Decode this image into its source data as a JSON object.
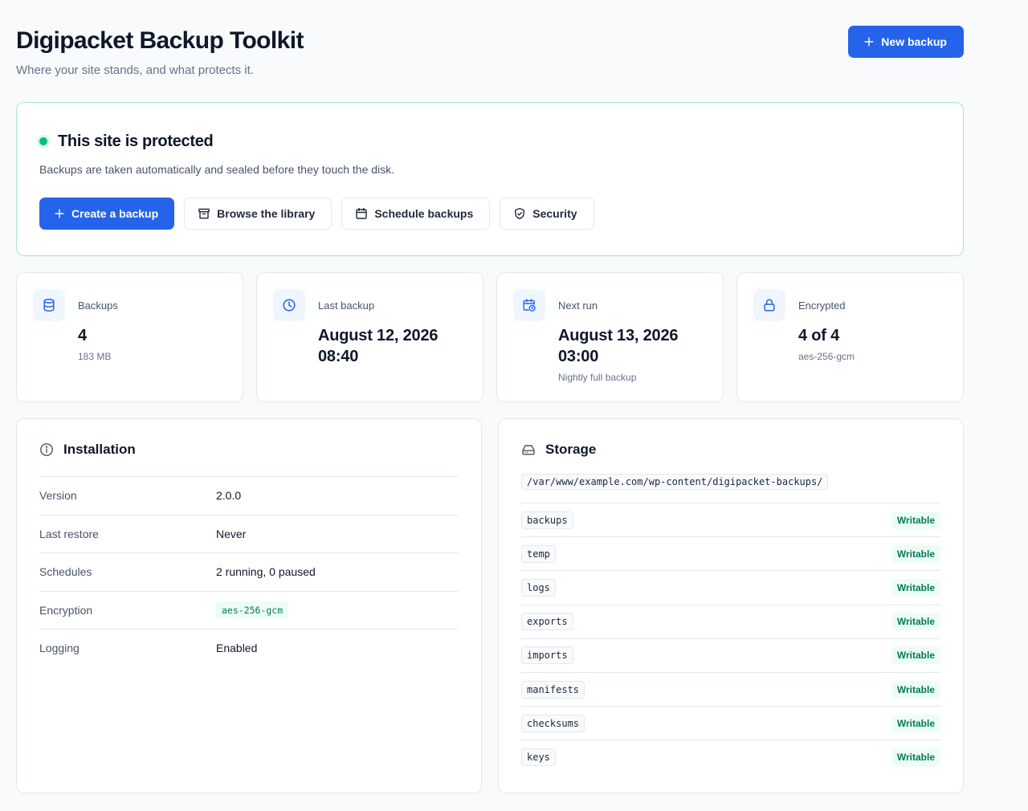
{
  "header": {
    "title": "Digipacket Backup Toolkit",
    "subtitle": "Where your site stands, and what protects it.",
    "new_backup_label": "New backup"
  },
  "status": {
    "title": "This site is protected",
    "description": "Backups are taken automatically and sealed before they touch the disk.",
    "actions": {
      "create": "Create a backup",
      "library": "Browse the library",
      "schedule": "Schedule backups",
      "security": "Security"
    }
  },
  "stats": [
    {
      "label": "Backups",
      "value": "4",
      "sub": "183 MB"
    },
    {
      "label": "Last backup",
      "value": "August 12, 2026 08:40",
      "sub": ""
    },
    {
      "label": "Next run",
      "value": "August 13, 2026 03:00",
      "sub": "Nightly full backup"
    },
    {
      "label": "Encrypted",
      "value": "4 of 4",
      "sub": "aes-256-gcm"
    }
  ],
  "installation": {
    "title": "Installation",
    "rows": [
      {
        "key": "Version",
        "value": "2.0.0"
      },
      {
        "key": "Last restore",
        "value": "Never"
      },
      {
        "key": "Schedules",
        "value": "2 running, 0 paused"
      },
      {
        "key": "Encryption",
        "value": "aes-256-gcm"
      },
      {
        "key": "Logging",
        "value": "Enabled"
      }
    ]
  },
  "storage": {
    "title": "Storage",
    "path": "/var/www/example.com/wp-content/digipacket-backups/",
    "dirs": [
      {
        "name": "backups",
        "status": "Writable"
      },
      {
        "name": "temp",
        "status": "Writable"
      },
      {
        "name": "logs",
        "status": "Writable"
      },
      {
        "name": "exports",
        "status": "Writable"
      },
      {
        "name": "imports",
        "status": "Writable"
      },
      {
        "name": "manifests",
        "status": "Writable"
      },
      {
        "name": "checksums",
        "status": "Writable"
      },
      {
        "name": "keys",
        "status": "Writable"
      }
    ]
  },
  "colors": {
    "accent": "#2563eb",
    "success": "#10b981",
    "success_text": "#047857",
    "success_bg": "#ecfdf5"
  }
}
